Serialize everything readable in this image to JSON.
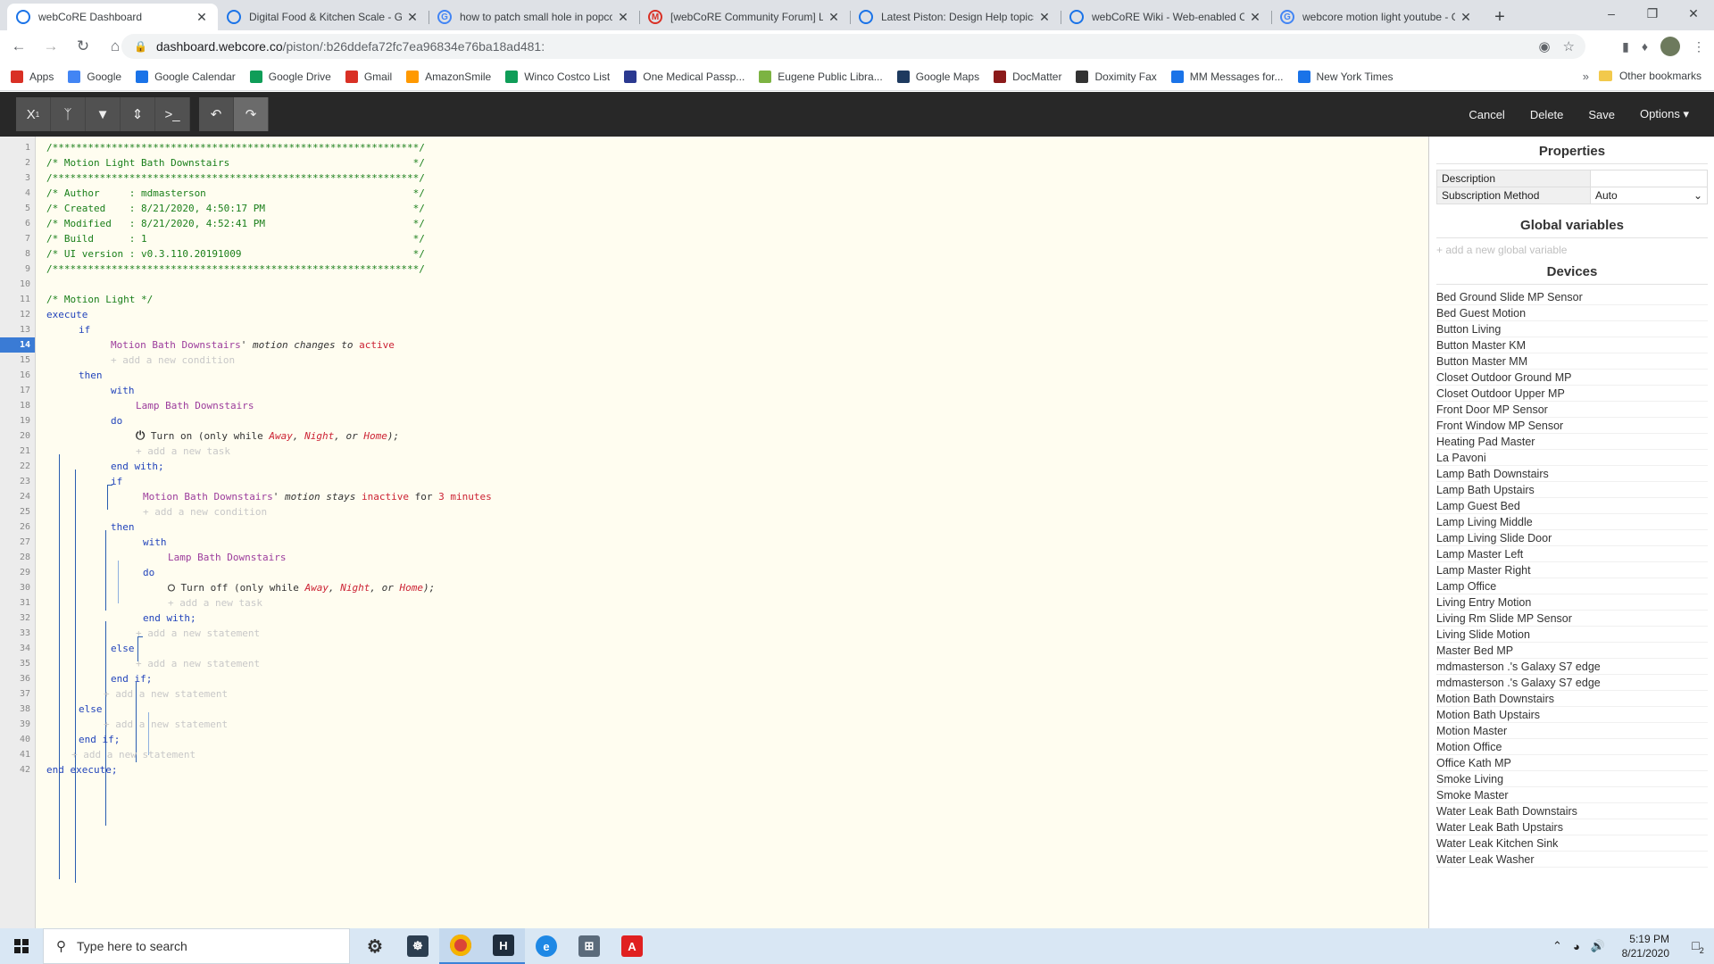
{
  "browser": {
    "tabs": [
      {
        "title": "webCoRE Dashboard",
        "icon": "webcore-icon",
        "color": "#1a73e8",
        "active": true
      },
      {
        "title": "Digital Food & Kitchen Scale - GE",
        "icon": "webcore-icon",
        "color": "#1a73e8",
        "active": false
      },
      {
        "title": "how to patch small hole in popcorn",
        "icon": "google-icon",
        "color": "#4285f4",
        "active": false
      },
      {
        "title": "[webCoRE Community Forum] Lo",
        "icon": "gmail-icon",
        "color": "#d93025",
        "active": false
      },
      {
        "title": "Latest Piston: Design Help topics",
        "icon": "webcore-icon",
        "color": "#1a73e8",
        "active": false
      },
      {
        "title": "webCoRE Wiki - Web-enabled Co",
        "icon": "webcore-icon",
        "color": "#1a73e8",
        "active": false
      },
      {
        "title": "webcore motion light youtube - G",
        "icon": "google-icon",
        "color": "#4285f4",
        "active": false
      }
    ],
    "url_host": "dashboard.webcore.co",
    "url_path": "/piston/:b26ddefa72fc7ea96834e76ba18ad481:",
    "bookmarks": [
      {
        "label": "Apps",
        "color": "#d93025"
      },
      {
        "label": "Google",
        "color": "#4285f4"
      },
      {
        "label": "Google Calendar",
        "color": "#1a73e8"
      },
      {
        "label": "Google Drive",
        "color": "#0f9d58"
      },
      {
        "label": "Gmail",
        "color": "#d93025"
      },
      {
        "label": "AmazonSmile",
        "color": "#ff9900"
      },
      {
        "label": "Winco Costco List",
        "color": "#0f9d58"
      },
      {
        "label": "One Medical Passp...",
        "color": "#2b3990"
      },
      {
        "label": "Eugene Public Libra...",
        "color": "#7cb342"
      },
      {
        "label": "Google Maps",
        "color": "#1e3a5f"
      },
      {
        "label": "DocMatter",
        "color": "#8b1a1a"
      },
      {
        "label": "Doximity Fax",
        "color": "#333333"
      },
      {
        "label": "MM Messages for...",
        "color": "#1a73e8"
      },
      {
        "label": "New York Times",
        "color": "#1a73e8"
      }
    ],
    "other_bookmarks": "Other bookmarks"
  },
  "app": {
    "menu": {
      "cancel": "Cancel",
      "delete": "Delete",
      "save": "Save",
      "options": "Options"
    },
    "code_lines": [
      "/**************************************************************/",
      "/* Motion Light Bath Downstairs                               */",
      "/**************************************************************/",
      "/* Author     : mdmasterson                                   */",
      "/* Created    : 8/21/2020, 4:50:17 PM                         */",
      "/* Modified   : 8/21/2020, 4:52:41 PM                         */",
      "/* Build      : 1                                             */",
      "/* UI version : v0.3.110.20191009                             */",
      "/**************************************************************/",
      "/* Motion Light */",
      "execute",
      "if",
      "Motion Bath Downstairs",
      "' motion changes to ",
      "active",
      "+ add a new condition",
      "then",
      "with",
      "Lamp Bath Downstairs",
      "do",
      "Turn on (only while ",
      "Away",
      "Night",
      "Home",
      "+ add a new task",
      "end with;",
      "if",
      "Motion Bath Downstairs",
      "' motion stays ",
      "inactive",
      " for ",
      "3 minutes",
      "+ add a new condition",
      "then",
      "with",
      "Lamp Bath Downstairs",
      "do",
      "Turn off (only while ",
      "Away",
      "Night",
      "Home",
      "+ add a new task",
      "end with;",
      "+ add a new statement",
      "else",
      "+ add a new statement",
      "end if;",
      "+ add a new statement",
      "else",
      "+ add a new statement",
      "end if;",
      "+ add a new statement",
      "end execute;"
    ],
    "current_line": "14",
    "properties": {
      "title": "Properties",
      "rows": [
        {
          "key": "Description",
          "value": ""
        },
        {
          "key": "Subscription Method",
          "value": "Auto"
        }
      ],
      "global_title": "Global variables",
      "add_variable": "+ add a new global variable",
      "devices_title": "Devices",
      "devices": [
        "Bed Ground Slide MP Sensor",
        "Bed Guest Motion",
        "Button Living",
        "Button Master KM",
        "Button Master MM",
        "Closet Outdoor Ground MP",
        "Closet Outdoor Upper MP",
        "Front Door MP Sensor",
        "Front Window MP Sensor",
        "Heating Pad Master",
        "La Pavoni",
        "Lamp Bath Downstairs",
        "Lamp Bath Upstairs",
        "Lamp Guest Bed",
        "Lamp Living Middle",
        "Lamp Living Slide Door",
        "Lamp Master Left",
        "Lamp Master Right",
        "Lamp Office",
        "Living Entry Motion",
        "Living Rm Slide MP Sensor",
        "Living Slide Motion",
        "Master Bed MP",
        "mdmasterson .'s Galaxy S7 edge",
        "mdmasterson .'s Galaxy S7 edge",
        "Motion Bath Downstairs",
        "Motion Bath Upstairs",
        "Motion Master",
        "Motion Office",
        "Office Kath MP",
        "Smoke Living",
        "Smoke Master",
        "Water Leak Bath Downstairs",
        "Water Leak Bath Upstairs",
        "Water Leak Kitchen Sink",
        "Water Leak Washer"
      ]
    }
  },
  "taskbar": {
    "search_placeholder": "Type here to search",
    "time": "5:19 PM",
    "date": "8/21/2020",
    "notification_count": "2"
  }
}
